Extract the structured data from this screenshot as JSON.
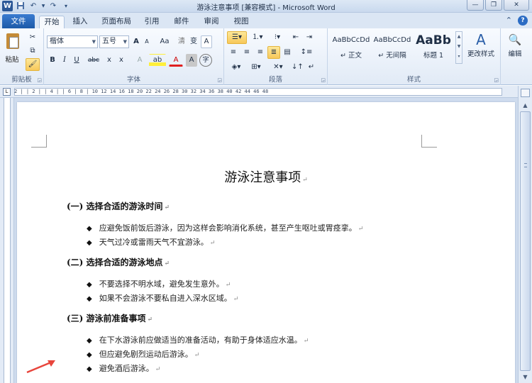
{
  "window": {
    "title": "游泳注意事项 [兼容模式] - Microsoft Word",
    "app_icon": "W",
    "qat_icons": [
      "save-icon",
      "undo-icon",
      "redo-icon",
      "customize-icon"
    ],
    "controls": [
      "minimize-icon",
      "restore-icon",
      "close-icon"
    ]
  },
  "tabs": {
    "file": "文件",
    "items": [
      "开始",
      "插入",
      "页面布局",
      "引用",
      "邮件",
      "审阅",
      "视图"
    ],
    "active": "开始",
    "right_icons": [
      "collapse-ribbon-icon",
      "help-icon"
    ]
  },
  "ribbon": {
    "clipboard": {
      "label": "剪贴板",
      "paste": "粘贴"
    },
    "font": {
      "label": "字体",
      "font_name": "楷体",
      "font_size": "五号",
      "grow": "A",
      "shrink": "A",
      "case": "Aa",
      "clear": "清",
      "phonetic": "变",
      "border_char": "A",
      "bold": "B",
      "italic": "I",
      "underline": "U",
      "strike": "abc",
      "subscript": "x",
      "superscript": "x",
      "effects": "A",
      "highlight": "ab",
      "color": "A",
      "shading": "A",
      "enclose": "字"
    },
    "paragraph": {
      "label": "段落"
    },
    "styles": {
      "label": "样式",
      "items": [
        {
          "sample": "AaBbCcDd",
          "name": "正文"
        },
        {
          "sample": "AaBbCcDd",
          "name": "无间隔"
        },
        {
          "sample": "AaBb",
          "name": "标题 1"
        }
      ],
      "change_styles": "更改样式"
    },
    "editing": {
      "label": "编辑"
    }
  },
  "document": {
    "title": "游泳注意事项",
    "sections": [
      {
        "heading": "(一) 选择合适的游泳时间",
        "bullets": [
          "应避免饭前饭后游泳，因为这样会影响消化系统，甚至产生呕吐或胃痉挛。",
          "天气过冷或雷雨天气不宜游泳。"
        ]
      },
      {
        "heading": "(二) 选择合适的游泳地点",
        "bullets": [
          "不要选择不明水域，避免发生意外。",
          "如果不会游泳不要私自进入深水区域。"
        ]
      },
      {
        "heading": "(三) 游泳前准备事项",
        "bullets": [
          "在下水游泳前应做适当的准备活动，有助于身体适应水温。",
          "但应避免剧烈运动后游泳。",
          "避免酒后游泳。"
        ]
      }
    ],
    "paragraph_mark": "↵",
    "bullet_glyph": "◆"
  },
  "ruler": {
    "scale": "2 |  | 2 |  | 4 |  | 6 | 8 |  10  12  14  16  18  20  22  24  26  28  30  32  34  36  38  40  42  44  46  48"
  },
  "colors": {
    "annotation_arrow": "#e8453c",
    "file_tab": "#2b6cc4"
  }
}
